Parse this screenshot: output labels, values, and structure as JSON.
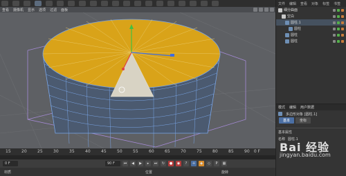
{
  "toolbar": {
    "icons": [
      "undo-icon",
      "redo-icon",
      "select-icon",
      "move-icon",
      "scale-icon",
      "rotate-icon",
      "x-axis-icon",
      "y-axis-icon",
      "z-axis-icon",
      "coord-icon",
      "render-icon",
      "render-settings-icon",
      "cube-icon",
      "pen-icon",
      "subdivision-icon",
      "array-icon",
      "deformer-icon",
      "scene-icon",
      "camera-icon",
      "light-icon"
    ]
  },
  "viewport": {
    "menu": [
      "查看",
      "摄像机",
      "显示",
      "选项",
      "过滤",
      "面板"
    ]
  },
  "object_manager": {
    "tabs": [
      "文件",
      "编辑",
      "查看",
      "对象",
      "标签",
      "书签"
    ],
    "rows": [
      {
        "label": "细分曲面",
        "indent": 0
      },
      {
        "label": "空白",
        "indent": 1
      },
      {
        "label": "圆柱.1",
        "indent": 2
      },
      {
        "label": "圆柱",
        "indent": 3
      },
      {
        "label": "圆柱",
        "indent": 2
      },
      {
        "label": "圆柱",
        "indent": 2
      }
    ]
  },
  "attributes": {
    "tabs": [
      "模式",
      "编辑",
      "用户数据"
    ],
    "title": "多边形对象 [圆柱.1]",
    "subtabs": [
      "基本",
      "坐标"
    ],
    "section": "基本属性",
    "name_label": "名称",
    "name_value": "圆柱.1"
  },
  "watermark": {
    "text": "Bai 经验",
    "url": "jingyan.baidu.com"
  },
  "timeline": {
    "ticks": [
      "15",
      "20",
      "25",
      "30",
      "35",
      "40",
      "45",
      "50",
      "55",
      "60",
      "65",
      "70",
      "75",
      "80",
      "85",
      "90"
    ],
    "end_label": "0 F",
    "current_frame": "0 F",
    "end_frame": "90 F"
  },
  "status": {
    "left": "材质",
    "mid": "位置",
    "right": "旋转"
  },
  "colors": {
    "top_face": "#d9a319",
    "selected_face": "#d8d3c4",
    "wire": "#7aa6e8",
    "bounding_box": "#a58ad6",
    "cylinder_side": "#4b5a70"
  }
}
